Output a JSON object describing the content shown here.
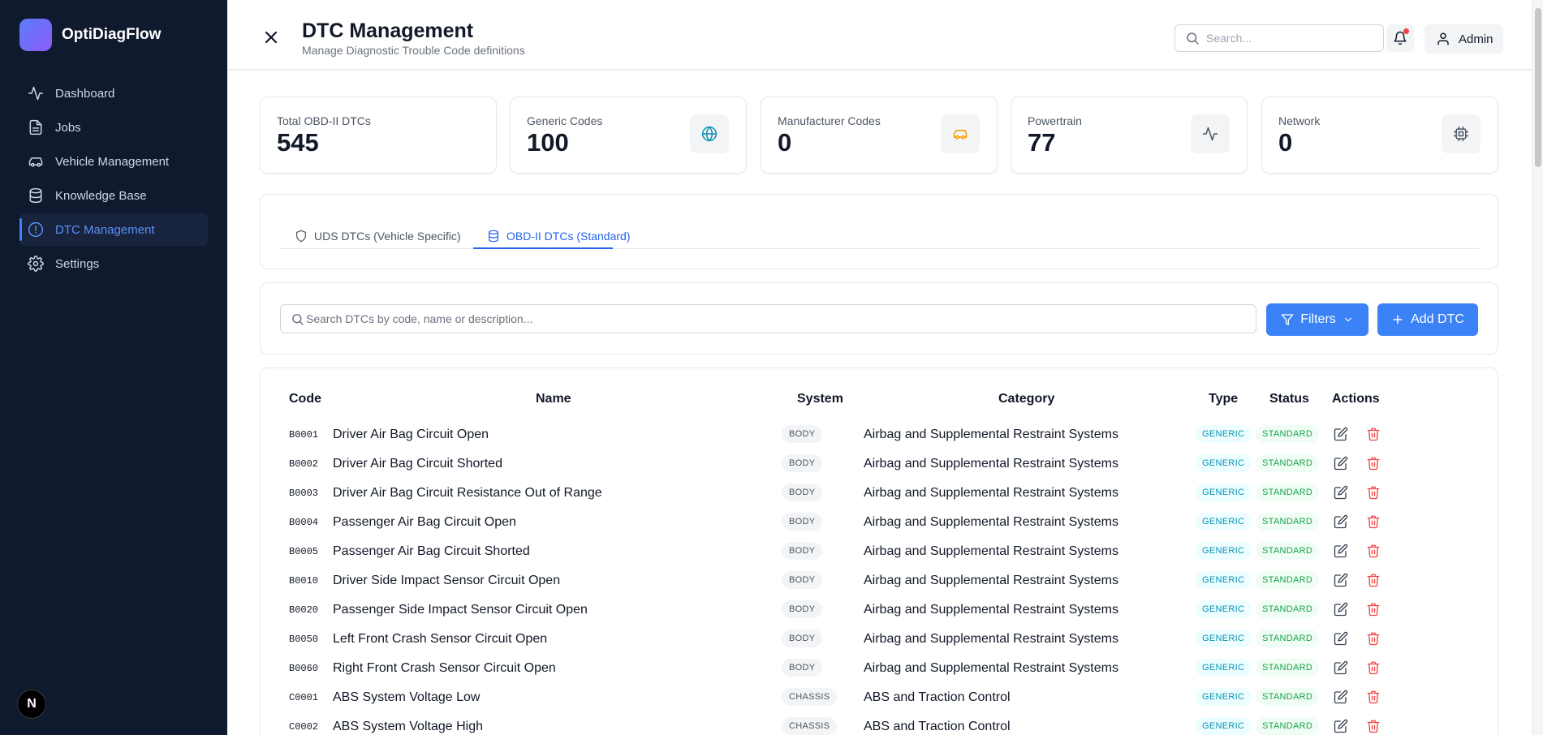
{
  "app": {
    "name": "OptiDiagFlow"
  },
  "sidebar": {
    "items": [
      {
        "label": "Dashboard",
        "icon": "activity-icon",
        "active": false
      },
      {
        "label": "Jobs",
        "icon": "file-icon",
        "active": false
      },
      {
        "label": "Vehicle Management",
        "icon": "car-icon",
        "active": false
      },
      {
        "label": "Knowledge Base",
        "icon": "database-icon",
        "active": false
      },
      {
        "label": "DTC Management",
        "icon": "alert-circle-icon",
        "active": true
      },
      {
        "label": "Settings",
        "icon": "gear-icon",
        "active": false
      }
    ],
    "badge": "N"
  },
  "header": {
    "title": "DTC Management",
    "subtitle": "Manage Diagnostic Trouble Code definitions",
    "search_placeholder": "Search...",
    "user_label": "Admin"
  },
  "stats": [
    {
      "label": "Total OBD-II DTCs",
      "value": "545",
      "icon": "none"
    },
    {
      "label": "Generic Codes",
      "value": "100",
      "icon": "globe-icon",
      "color": "#0891b2"
    },
    {
      "label": "Manufacturer Codes",
      "value": "0",
      "icon": "car-icon",
      "color": "#f59e0b"
    },
    {
      "label": "Powertrain",
      "value": "77",
      "icon": "activity-icon",
      "color": "#4b5563"
    },
    {
      "label": "Network",
      "value": "0",
      "icon": "cpu-icon",
      "color": "#4b5563"
    }
  ],
  "tabs": [
    {
      "label": "UDS DTCs (Vehicle Specific)",
      "active": false
    },
    {
      "label": "OBD-II DTCs (Standard)",
      "active": true
    }
  ],
  "toolbar": {
    "search_placeholder": "Search DTCs by code, name or description...",
    "filters_label": "Filters",
    "add_label": "Add DTC"
  },
  "table": {
    "columns": [
      "Code",
      "Name",
      "System",
      "Category",
      "Type",
      "Status",
      "Actions"
    ],
    "rows": [
      {
        "code": "B0001",
        "name": "Driver Air Bag Circuit Open",
        "system": "BODY",
        "category": "Airbag and Supplemental Restraint Systems",
        "type": "GENERIC",
        "status": "STANDARD"
      },
      {
        "code": "B0002",
        "name": "Driver Air Bag Circuit Shorted",
        "system": "BODY",
        "category": "Airbag and Supplemental Restraint Systems",
        "type": "GENERIC",
        "status": "STANDARD"
      },
      {
        "code": "B0003",
        "name": "Driver Air Bag Circuit Resistance Out of Range",
        "system": "BODY",
        "category": "Airbag and Supplemental Restraint Systems",
        "type": "GENERIC",
        "status": "STANDARD"
      },
      {
        "code": "B0004",
        "name": "Passenger Air Bag Circuit Open",
        "system": "BODY",
        "category": "Airbag and Supplemental Restraint Systems",
        "type": "GENERIC",
        "status": "STANDARD"
      },
      {
        "code": "B0005",
        "name": "Passenger Air Bag Circuit Shorted",
        "system": "BODY",
        "category": "Airbag and Supplemental Restraint Systems",
        "type": "GENERIC",
        "status": "STANDARD"
      },
      {
        "code": "B0010",
        "name": "Driver Side Impact Sensor Circuit Open",
        "system": "BODY",
        "category": "Airbag and Supplemental Restraint Systems",
        "type": "GENERIC",
        "status": "STANDARD"
      },
      {
        "code": "B0020",
        "name": "Passenger Side Impact Sensor Circuit Open",
        "system": "BODY",
        "category": "Airbag and Supplemental Restraint Systems",
        "type": "GENERIC",
        "status": "STANDARD"
      },
      {
        "code": "B0050",
        "name": "Left Front Crash Sensor Circuit Open",
        "system": "BODY",
        "category": "Airbag and Supplemental Restraint Systems",
        "type": "GENERIC",
        "status": "STANDARD"
      },
      {
        "code": "B0060",
        "name": "Right Front Crash Sensor Circuit Open",
        "system": "BODY",
        "category": "Airbag and Supplemental Restraint Systems",
        "type": "GENERIC",
        "status": "STANDARD"
      },
      {
        "code": "C0001",
        "name": "ABS System Voltage Low",
        "system": "CHASSIS",
        "category": "ABS and Traction Control",
        "type": "GENERIC",
        "status": "STANDARD"
      },
      {
        "code": "C0002",
        "name": "ABS System Voltage High",
        "system": "CHASSIS",
        "category": "ABS and Traction Control",
        "type": "GENERIC",
        "status": "STANDARD"
      }
    ]
  }
}
